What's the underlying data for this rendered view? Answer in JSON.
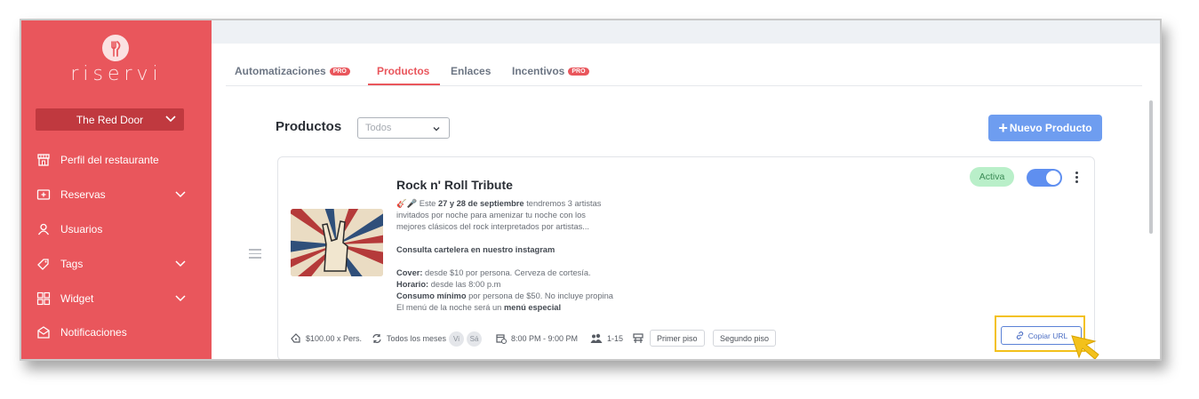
{
  "sidebar": {
    "brand": "riservi",
    "restaurant": "The Red Door",
    "items": [
      {
        "label": "Perfil del restaurante",
        "icon": "store-icon"
      },
      {
        "label": "Reservas",
        "icon": "calendar-plus-icon",
        "expandable": true
      },
      {
        "label": "Usuarios",
        "icon": "user-icon"
      },
      {
        "label": "Tags",
        "icon": "tag-icon",
        "expandable": true
      },
      {
        "label": "Widget",
        "icon": "widget-grid-icon",
        "expandable": true
      },
      {
        "label": "Notificaciones",
        "icon": "envelope-icon"
      }
    ]
  },
  "tabs": [
    {
      "label": "Automatizaciones",
      "badge": "PRO"
    },
    {
      "label": "Productos",
      "active": true
    },
    {
      "label": "Enlaces"
    },
    {
      "label": "Incentivos",
      "badge": "PRO"
    }
  ],
  "products": {
    "title": "Productos",
    "filter_value": "Todos",
    "new_button": "Nuevo Producto"
  },
  "card": {
    "title": "Rock n' Roll Tribute",
    "status": "Activa",
    "toggle_on": true,
    "desc": {
      "line1_emoji": "🎸🎤",
      "line1_pre": "Este",
      "line1_bold": "27 y 28 de septiembre",
      "line1_post": "tendremos 3 artistas",
      "line2": "invitados por noche para amenizar tu noche con los",
      "line3": "mejores clásicos del rock interpretados por artistas...",
      "insta": "Consulta cartelera en nuestro instagram",
      "cover_label": "Cover:",
      "cover_text": "desde $10 por persona. Cerveza de cortesía.",
      "horario_label": "Horario:",
      "horario_text": "desde las 8:00 p.m",
      "consumo_label": "Consumo mínimo",
      "consumo_text": "por persona de $50. No incluye propina",
      "menu_pre": "El menú de la noche será un",
      "menu_bold": "menú especial"
    },
    "footer": {
      "price": "$100.00 x Pers.",
      "recurrence": "Todos los meses",
      "days": [
        "Vi",
        "Sá"
      ],
      "time": "8:00 PM - 9:00 PM",
      "people": "1-15",
      "areas": [
        "Primer piso",
        "Segundo piso"
      ],
      "copy_url": "Copiar URL"
    }
  },
  "colors": {
    "brand_red": "#e9565c",
    "accent_blue": "#6e9df0",
    "active_green_bg": "#b9efc9",
    "highlight_yellow": "#f3c11b"
  }
}
